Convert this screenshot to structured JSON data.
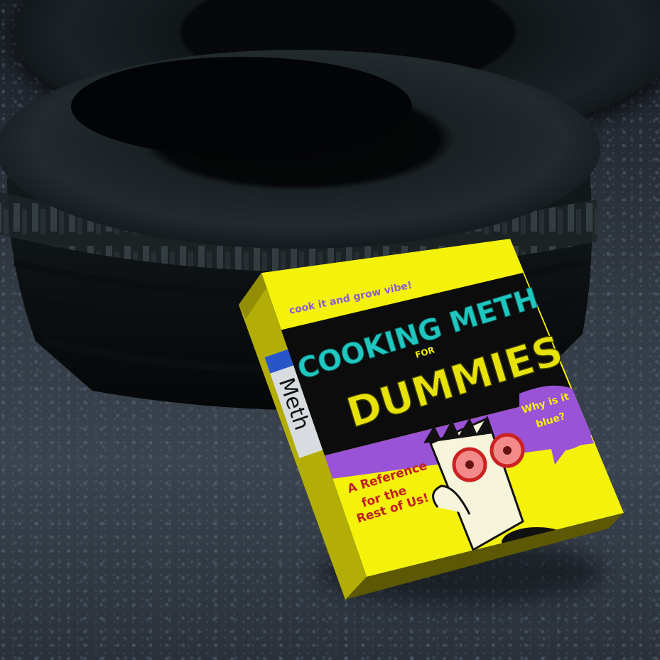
{
  "book": {
    "tagline": "cook it and grow vibe!",
    "title_line1": "COOKING METH",
    "title_for": "FOR",
    "title_line2": "DUMMIES",
    "bubble_line1": "Why is it",
    "bubble_line2": "blue?",
    "reference_line1": "A Reference",
    "reference_line2": "for the",
    "reference_line3": "Rest of Us!",
    "spine_label": "Meth"
  },
  "colors": {
    "cover_yellow": "#f4f20a",
    "title_teal": "#1fc7c0",
    "band_purple": "#9a52d6",
    "spine_yellow": "#b3ad08"
  }
}
